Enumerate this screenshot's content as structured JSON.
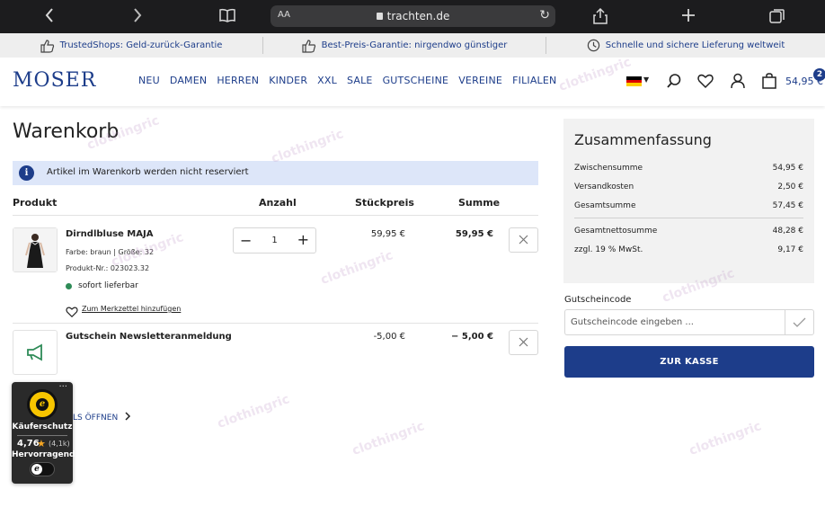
{
  "browser": {
    "url": "trachten.de",
    "text_size_label": "AA"
  },
  "trust_bar": [
    "TrustedShops: Geld-zurück-Garantie",
    "Best-Preis-Garantie: nirgendwo günstiger",
    "Schnelle und sichere Lieferung weltweit"
  ],
  "header": {
    "logo": "MOSER",
    "nav": [
      "NEU",
      "DAMEN",
      "HERREN",
      "KINDER",
      "XXL",
      "SALE",
      "GUTSCHEINE",
      "VEREINE",
      "FILIALEN"
    ],
    "cart_total": "54,95 €",
    "cart_count": "2",
    "flag_colors": [
      "#000000",
      "#dd0000",
      "#ffce00"
    ]
  },
  "cart": {
    "title": "Warenkorb",
    "notice": "Artikel im Warenkorb werden nicht reserviert",
    "columns": {
      "product": "Produkt",
      "quantity": "Anzahl",
      "unit_price": "Stückpreis",
      "total": "Summe"
    },
    "items": [
      {
        "name": "Dirndlbluse MAJA",
        "color_size": "Farbe: braun | Größe: 32",
        "product_no": "Produkt-Nr.: 023023.32",
        "stock": "sofort lieferbar",
        "wishlist": "Zum Merkzettel hinzufügen",
        "quantity": "1",
        "unit_price": "59,95 €",
        "total": "59,95 €"
      },
      {
        "name": "Gutschein Newsletteranmeldung",
        "unit_price": "-5,00 €",
        "total": "− 5,00 €"
      }
    ],
    "details_link": "LS ÖFFNEN"
  },
  "trusted_badge": {
    "label": "Käuferschutz",
    "rating": "4,76",
    "count": "(4,1k)",
    "verdict": "Hervorragend",
    "more": "···"
  },
  "summary": {
    "title": "Zusammenfassung",
    "rows": [
      {
        "label": "Zwischensumme",
        "value": "54,95 €"
      },
      {
        "label": "Versandkosten",
        "value": "2,50 €"
      },
      {
        "label": "Gesamtsumme",
        "value": "57,45 €"
      },
      {
        "label": "Gesamtnettosumme",
        "value": "48,28 €"
      },
      {
        "label": "zzgl. 19 % MwSt.",
        "value": "9,17 €"
      }
    ],
    "coupon_label": "Gutscheincode",
    "coupon_placeholder": "Gutscheincode eingeben ...",
    "checkout": "ZUR KASSE"
  },
  "watermark": "clothingric",
  "colors": {
    "brand": "#1d3d8a",
    "stock_green": "#2e8b57",
    "notice_bg": "#dde6f9"
  }
}
